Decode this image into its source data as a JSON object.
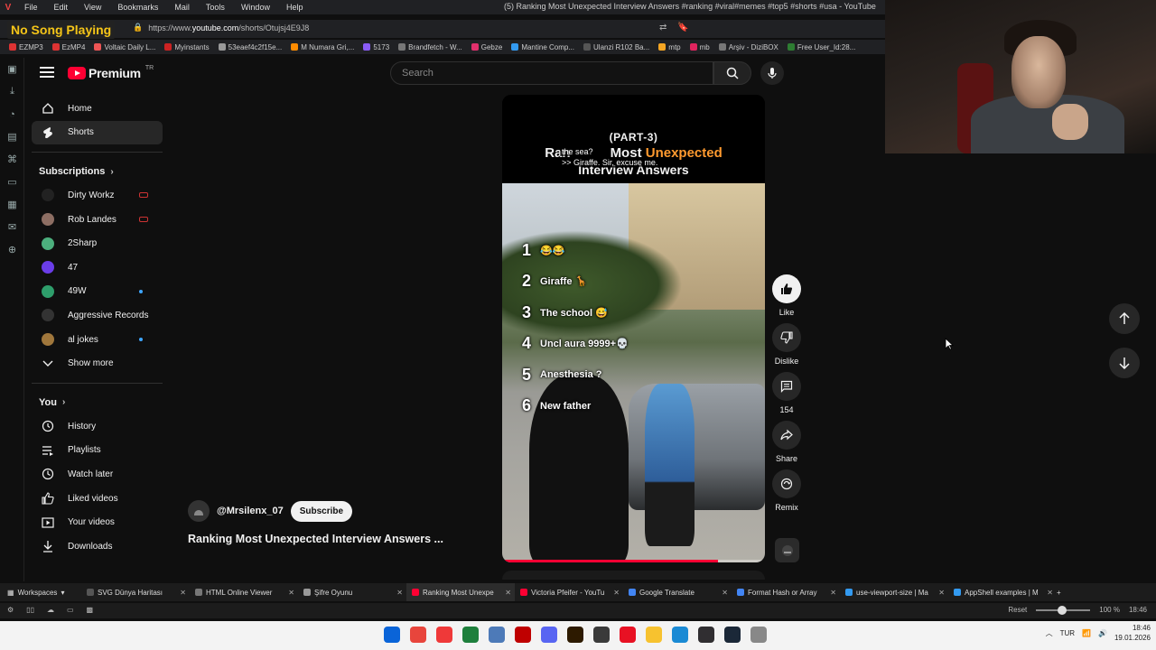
{
  "menubar": {
    "items": [
      "File",
      "Edit",
      "View",
      "Bookmarks",
      "Mail",
      "Tools",
      "Window",
      "Help"
    ],
    "window_title": "(5) Ranking Most Unexpected Interview Answers #ranking #viral#memes #top5 #shorts #usa - YouTube"
  },
  "overlay": {
    "now_playing": "No Song Playing"
  },
  "address": {
    "url_prefix": "https://www.",
    "url_domain": "youtube.com",
    "url_path": "/shorts/Otujsj4E9J8"
  },
  "bookmarks": [
    {
      "label": "EZMP3",
      "color": "#d33"
    },
    {
      "label": "EzMP4",
      "color": "#d33"
    },
    {
      "label": "Voltaic Daily L...",
      "color": "#e55"
    },
    {
      "label": "Myinstants",
      "color": "#c22"
    },
    {
      "label": "53eaef4c2f15e...",
      "color": "#999"
    },
    {
      "label": "M Numara Gri,...",
      "color": "#ff8c00"
    },
    {
      "label": "5173",
      "color": "#8a5cf6"
    },
    {
      "label": "Brandfetch - W...",
      "color": "#777"
    },
    {
      "label": "Gebze",
      "color": "#e1306c"
    },
    {
      "label": "Mantine Comp...",
      "color": "#339af0"
    },
    {
      "label": "Ulanzi R102 Ba...",
      "color": "#555"
    },
    {
      "label": "mtp",
      "color": "#f5a623"
    },
    {
      "label": "mb",
      "color": "#e0245e"
    },
    {
      "label": "Arşiv - DiziBOX",
      "color": "#777"
    },
    {
      "label": "Free User_Id:28...",
      "color": "#2e7d32"
    }
  ],
  "header": {
    "logo_word": "Premium",
    "logo_region": "TR",
    "search_placeholder": "Search"
  },
  "nav": {
    "main": [
      {
        "label": "Home",
        "active": false
      },
      {
        "label": "Shorts",
        "active": true
      }
    ],
    "subscriptions_title": "Subscriptions",
    "subscriptions": [
      {
        "label": "Dirty Workz",
        "avatar": "#222",
        "badge": "live"
      },
      {
        "label": "Rob Landes",
        "avatar": "#8d6e63",
        "badge": "live"
      },
      {
        "label": "2Sharp",
        "avatar": "#4caf7d",
        "badge": ""
      },
      {
        "label": "47",
        "avatar": "#6a3de8",
        "badge": ""
      },
      {
        "label": "49W",
        "avatar": "#2e9e6b",
        "badge": "new"
      },
      {
        "label": "Aggressive Records",
        "avatar": "#333",
        "badge": ""
      },
      {
        "label": "al jokes",
        "avatar": "#a0773c",
        "badge": "new"
      }
    ],
    "show_more": "Show more",
    "you_title": "You",
    "you": [
      {
        "label": "History",
        "icon": "history-icon"
      },
      {
        "label": "Playlists",
        "icon": "playlists-icon"
      },
      {
        "label": "Watch later",
        "icon": "watch-later-icon"
      },
      {
        "label": "Liked videos",
        "icon": "like-icon"
      },
      {
        "label": "Your videos",
        "icon": "your-videos-icon"
      },
      {
        "label": "Downloads",
        "icon": "download-icon"
      }
    ]
  },
  "short": {
    "part": "(PART-3)",
    "title_a": "Ran",
    "title_b": "Most ",
    "title_c": "Unexpected",
    "title_line2": "Interview Answers",
    "subtitle_1": "the sea?",
    "subtitle_2": ">> Giraffe. Sir, excuse me.",
    "list": [
      {
        "num": "1",
        "text": "😂😂"
      },
      {
        "num": "2",
        "text": "Giraffe 🦒"
      },
      {
        "num": "3",
        "text": "The school 😅"
      },
      {
        "num": "4",
        "text": "Uncl aura 9999+💀"
      },
      {
        "num": "5",
        "text": "Anesthesia ?"
      },
      {
        "num": "6",
        "text": "New father"
      }
    ],
    "progress": 0.82,
    "channel": "@Mrsilenx_07",
    "subscribe_label": "Subscribe",
    "title": "Ranking Most Unexpected Interview Answers ..."
  },
  "actions": {
    "like": "Like",
    "dislike": "Dislike",
    "comments": "154",
    "share": "Share",
    "remix": "Remix"
  },
  "tabs": {
    "workspaces": "Workspaces",
    "items": [
      {
        "label": "SVG Dünya Haritası",
        "active": false,
        "color": "#555"
      },
      {
        "label": "HTML Online Viewer",
        "active": false,
        "color": "#777"
      },
      {
        "label": "Şifre Oyunu",
        "active": false,
        "color": "#999"
      },
      {
        "label": "Ranking Most Unexpe",
        "active": true,
        "color": "#ff0033"
      },
      {
        "label": "Victoria Pfeifer - YouTu",
        "active": false,
        "color": "#ff0033"
      },
      {
        "label": "Google Translate",
        "active": false,
        "color": "#4285f4"
      },
      {
        "label": "Format Hash or Array",
        "active": false,
        "color": "#4285f4"
      },
      {
        "label": "use-viewport-size | Ma",
        "active": false,
        "color": "#339af0"
      },
      {
        "label": "AppShell examples | M",
        "active": false,
        "color": "#339af0"
      }
    ]
  },
  "status": {
    "reset": "Reset",
    "zoom": "100 %",
    "time": "18:46"
  },
  "taskbar": {
    "icons": [
      {
        "name": "windows-start-icon",
        "color": "#0a64d8"
      },
      {
        "name": "chrome-icon",
        "color": "#e8453c"
      },
      {
        "name": "vivaldi-icon",
        "color": "#ef3939"
      },
      {
        "name": "terminal-icon",
        "color": "#1e7f3c"
      },
      {
        "name": "app-icon",
        "color": "#4d7ab8"
      },
      {
        "name": "filezilla-icon",
        "color": "#bf0000"
      },
      {
        "name": "discord-icon",
        "color": "#5865f2"
      },
      {
        "name": "illustrator-icon",
        "color": "#2d1a00"
      },
      {
        "name": "app-icon-2",
        "color": "#3a3a3a"
      },
      {
        "name": "record-icon",
        "color": "#e81123"
      },
      {
        "name": "explorer-icon",
        "color": "#f7c22f"
      },
      {
        "name": "vscode-icon",
        "color": "#1a8ad4"
      },
      {
        "name": "obs-icon",
        "color": "#302e31"
      },
      {
        "name": "steam-icon",
        "color": "#1b2838"
      },
      {
        "name": "app-icon-3",
        "color": "#888"
      }
    ],
    "lang": "TUR",
    "time": "18:46",
    "date": "19.01.2026"
  }
}
